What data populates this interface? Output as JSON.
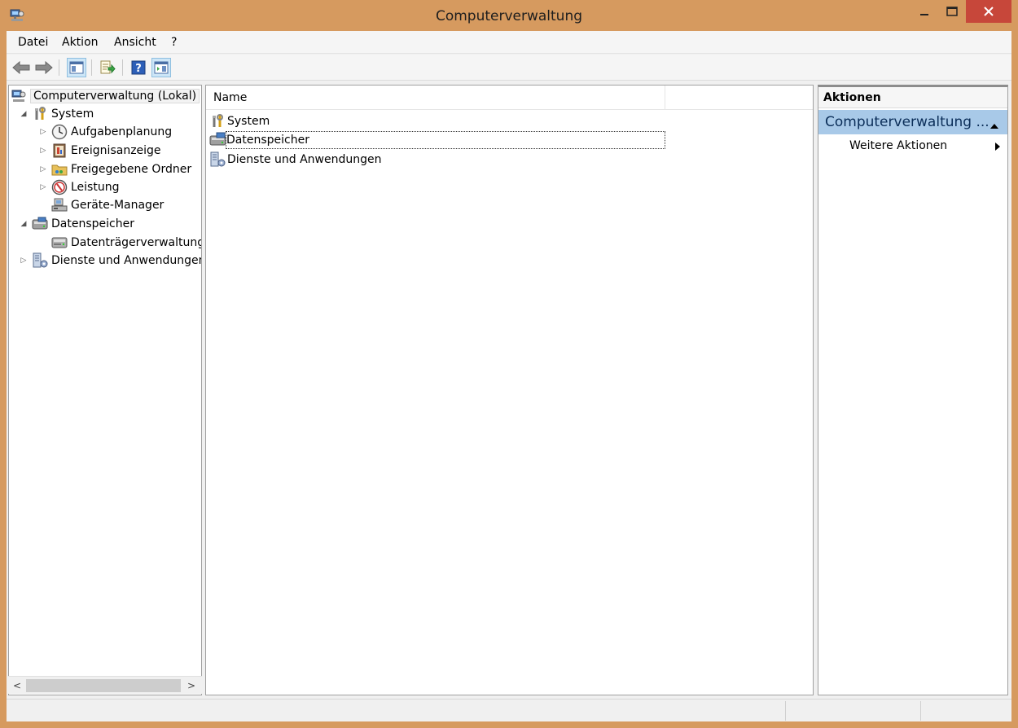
{
  "window": {
    "title": "Computerverwaltung"
  },
  "menu": {
    "items": [
      "Datei",
      "Aktion",
      "Ansicht",
      "?"
    ]
  },
  "toolbar": {
    "buttons": [
      "back-arrow-icon",
      "forward-arrow-icon",
      "show-hide-console-tree-icon",
      "export-list-icon",
      "help-icon",
      "show-hide-action-pane-icon"
    ]
  },
  "tree": {
    "root": "Computerverwaltung (Lokal)",
    "system": "System",
    "task_scheduler": "Aufgabenplanung",
    "event_viewer": "Ereignisanzeige",
    "shared_folders": "Freigegebene Ordner",
    "performance": "Leistung",
    "device_manager": "Geräte-Manager",
    "storage": "Datenspeicher",
    "disk_management": "Datenträgerverwaltung",
    "services": "Dienste und Anwendungen"
  },
  "list": {
    "column_name": "Name",
    "items": [
      "System",
      "Datenspeicher",
      "Dienste und Anwendungen"
    ]
  },
  "actions": {
    "header": "Aktionen",
    "group": "Computerverwaltung ...",
    "more": "Weitere Aktionen"
  },
  "colors": {
    "frame": "#d69a5f",
    "close": "#c7473a",
    "action_group": "#a8c9e8"
  }
}
